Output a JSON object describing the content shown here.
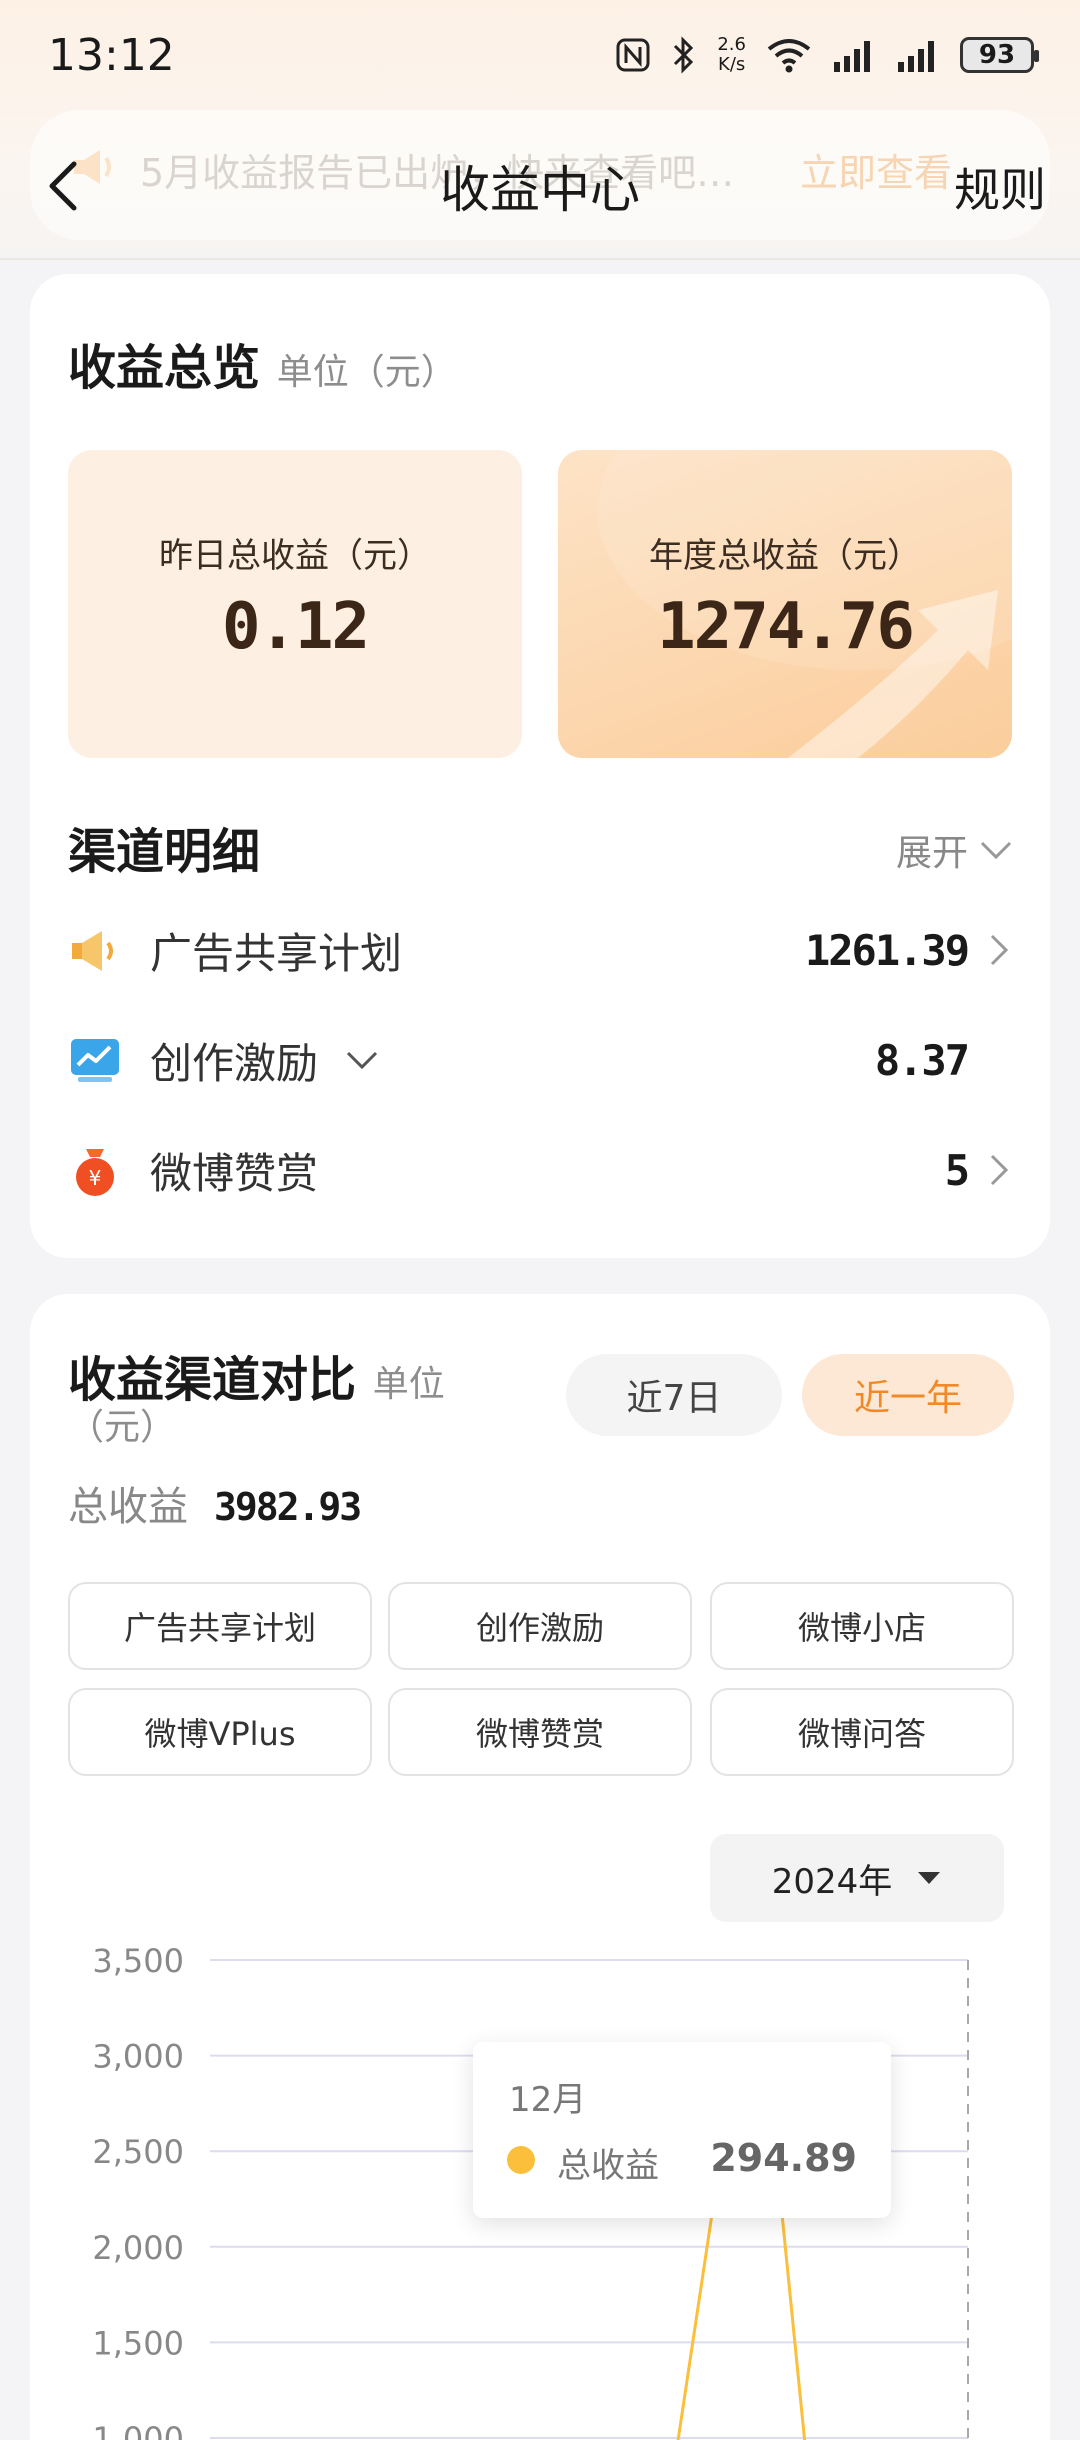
{
  "status_bar": {
    "time": "13:12",
    "net_speed_value": "2.6",
    "net_speed_unit": "K/s",
    "battery": "93"
  },
  "header": {
    "notice_text": "5月收益报告已出炉，快来查看吧…",
    "notice_link": "立即查看",
    "title": "收益中心",
    "rules": "规则"
  },
  "overview": {
    "title": "收益总览",
    "unit": "单位（元）",
    "yesterday_label": "昨日总收益（元）",
    "yesterday_value": "0.12",
    "annual_label": "年度总收益（元）",
    "annual_value": "1274.76"
  },
  "channels": {
    "title": "渠道明细",
    "expand_label": "展开",
    "items": [
      {
        "name": "广告共享计划",
        "value": "1261.39",
        "icon": "megaphone-icon"
      },
      {
        "name": "创作激励",
        "value": "8.37",
        "icon": "trend-chart-icon"
      },
      {
        "name": "微博赞赏",
        "value": "5",
        "icon": "money-bag-icon"
      }
    ]
  },
  "comparison": {
    "title": "收益渠道对比",
    "unit_line1": "单位",
    "unit_line2": "（元）",
    "range_week": "近7日",
    "range_year": "近一年",
    "total_label": "总收益",
    "total_value": "3982.93",
    "tags": [
      "广告共享计划",
      "创作激励",
      "微博小店",
      "微博VPlus",
      "微博赞赏",
      "微博问答"
    ],
    "year_select": "2024年",
    "tooltip": {
      "month": "12月",
      "series": "总收益",
      "value": "294.89"
    }
  },
  "colors": {
    "accent": "#f08a28",
    "line": "#fbbf3b"
  },
  "chart_data": {
    "type": "line",
    "y_ticks": [
      "3,500",
      "3,000",
      "2,500",
      "2,000",
      "1,500",
      "1,000"
    ],
    "ylim": [
      1000,
      3500
    ],
    "series": [
      {
        "name": "总收益"
      }
    ]
  }
}
